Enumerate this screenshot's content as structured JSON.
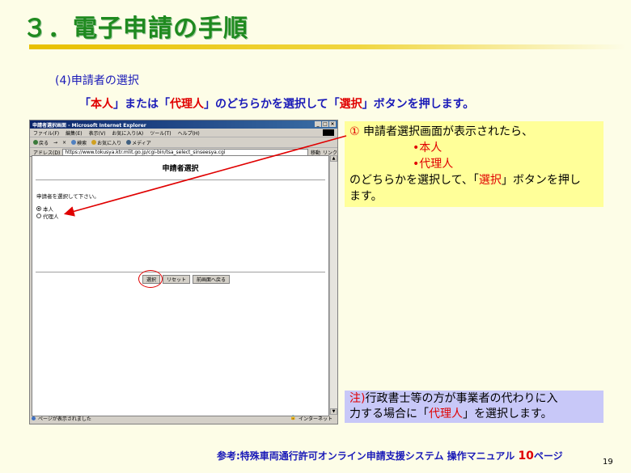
{
  "slide": {
    "title": "３．電子申請の手順",
    "subheading": "(4)申請者の選択",
    "instruction": {
      "q1": "「",
      "opt1": "本人",
      "mid1": "」または「",
      "opt2": "代理人",
      "mid2": "」のどちらかを選択して「",
      "select": "選択",
      "end": "」ボタンを押します。"
    },
    "page_number": "19"
  },
  "browser": {
    "window_title": "申請者選択画面 - Microsoft Internet Explorer",
    "window_buttons": [
      "_",
      "□",
      "×"
    ],
    "menu": [
      "ファイル(F)",
      "編集(E)",
      "表示(V)",
      "お気に入り(A)",
      "ツール(T)",
      "ヘルプ(H)"
    ],
    "toolbar": [
      "戻る",
      "→",
      "×",
      "検索",
      "お気に入り",
      "メディア"
    ],
    "address_label": "アドレス(D)",
    "url": "https://www.tokusya.ktr.mlit.go.jp/cgi-bin/tsa_select_sinseesya.cgi",
    "go_label": "移動",
    "links_label": "リンク",
    "status_left": "ページが表示されました",
    "status_right": "インターネット"
  },
  "form": {
    "heading": "申請者選択",
    "prompt": "申請者を選択して下さい。",
    "options": [
      {
        "label": "本人",
        "checked": true
      },
      {
        "label": "代理人",
        "checked": false
      }
    ],
    "buttons": {
      "select": "選択",
      "reset": "リセット",
      "back": "前画面へ戻る"
    }
  },
  "callout": {
    "line1_num": "①",
    "line1_text": " 申請者選択画面が表示されたら、",
    "opt1": "•本人",
    "opt2": "•代理人",
    "line4_a": "のどちらかを選択して、「",
    "line4_select": "選択",
    "line4_b": "」ボタンを押し",
    "line5": "ます。"
  },
  "note": {
    "prefix": "注)",
    "line1": "行政書士等の方が事業者の代わりに入",
    "line2_a": "力する場合に「",
    "line2_red": "代理人",
    "line2_b": "」を選択します。"
  },
  "footer": {
    "text_a": "参考:特殊車両通行許可オンライン申請支援システム 操作マニュアル ",
    "page_ref": "10",
    "text_b": "ページ"
  },
  "colors": {
    "title_green": "#1f8a1f",
    "navy": "#1a1ab8",
    "red": "#e00000",
    "callout_bg": "#ffff99",
    "note_bg": "#c8c8f8"
  }
}
